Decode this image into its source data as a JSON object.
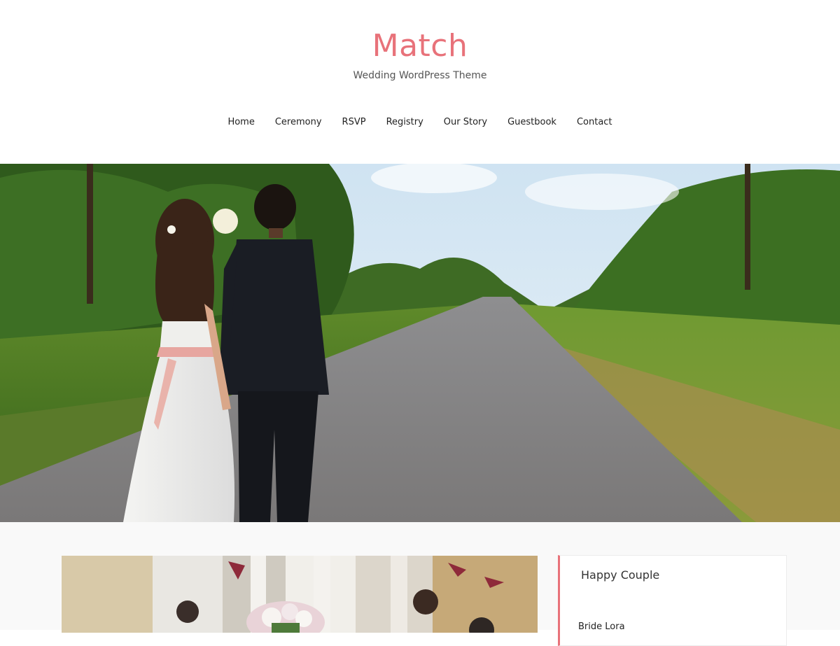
{
  "site": {
    "title": "Match",
    "tagline": "Wedding WordPress Theme",
    "accent_color": "#e8727a"
  },
  "nav": {
    "items": [
      {
        "label": "Home"
      },
      {
        "label": "Ceremony"
      },
      {
        "label": "RSVP"
      },
      {
        "label": "Registry"
      },
      {
        "label": "Our Story"
      },
      {
        "label": "Guestbook"
      },
      {
        "label": "Contact"
      }
    ]
  },
  "hero": {
    "image": "bride-and-groom-on-country-road-photo"
  },
  "main": {
    "post_thumbnail": "wedding-celebration-bouquet-photo"
  },
  "sidebar": {
    "widget": {
      "title": "Happy Couple",
      "text": "Bride Lora"
    }
  }
}
